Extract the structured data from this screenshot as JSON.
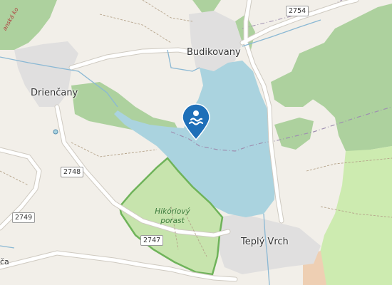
{
  "map": {
    "colors": {
      "land": "#f2efe9",
      "water": "#aad3df",
      "forest": "#add19e",
      "reserve_fill": "#c7e4ad",
      "reserve_border": "#6fb35a",
      "road": "#ffffff",
      "road_casing": "#cfcac1",
      "pin": "#1e6fb8"
    },
    "places": {
      "budikovany": "Budikovany",
      "driencany": "Drienčany",
      "teply_vrch": "Teplý Vrch",
      "partial_bottom_left": "ča",
      "partial_top_left": "anská ko"
    },
    "roads": {
      "r2754": "2754",
      "r2748": "2748",
      "r2749": "2749",
      "r2747": "2747"
    },
    "reserve": {
      "line1": "Hikóriový",
      "line2": "porast"
    },
    "pin": {
      "icon": "swimming-icon"
    }
  }
}
